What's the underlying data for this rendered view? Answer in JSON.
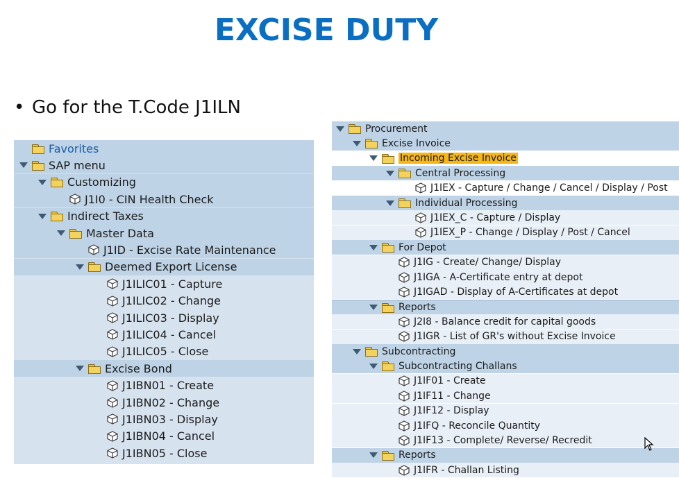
{
  "title": "EXCISE DUTY",
  "bullet": {
    "text": "Go for the T.Code J1ILN"
  },
  "colors": {
    "title": "#0a6fc2",
    "highlight": "#f5b617",
    "band": "#bed3e6",
    "panel": "#d6e2ee"
  },
  "left_tree": [
    {
      "label": "Favorites",
      "indent": 0,
      "node": "folder",
      "expander": "none",
      "style": "band",
      "fav": true
    },
    {
      "label": "SAP menu",
      "indent": 0,
      "node": "folder",
      "expander": "open",
      "style": "band"
    },
    {
      "label": "Customizing",
      "indent": 1,
      "node": "folder",
      "expander": "open",
      "style": "band"
    },
    {
      "label": "J1I0 - CIN Health Check",
      "indent": 2,
      "node": "cube",
      "expander": "none",
      "style": "band"
    },
    {
      "label": "Indirect Taxes",
      "indent": 1,
      "node": "folder",
      "expander": "open",
      "style": "band"
    },
    {
      "label": "Master Data",
      "indent": 2,
      "node": "folder",
      "expander": "open",
      "style": "band"
    },
    {
      "label": "J1ID - Excise Rate Maintenance",
      "indent": 3,
      "node": "cube",
      "expander": "none",
      "style": "band"
    },
    {
      "label": "Deemed Export License",
      "indent": 3,
      "node": "folder",
      "expander": "open",
      "style": "band"
    },
    {
      "label": "J1ILIC01 - Capture",
      "indent": 4,
      "node": "cube",
      "expander": "none",
      "style": "panel"
    },
    {
      "label": "J1ILIC02 - Change",
      "indent": 4,
      "node": "cube",
      "expander": "none",
      "style": "panel"
    },
    {
      "label": "J1ILIC03 - Display",
      "indent": 4,
      "node": "cube",
      "expander": "none",
      "style": "panel"
    },
    {
      "label": "J1ILIC04 - Cancel",
      "indent": 4,
      "node": "cube",
      "expander": "none",
      "style": "panel"
    },
    {
      "label": "J1ILIC05 - Close",
      "indent": 4,
      "node": "cube",
      "expander": "none",
      "style": "panel"
    },
    {
      "label": "Excise Bond",
      "indent": 3,
      "node": "folder",
      "expander": "open",
      "style": "band"
    },
    {
      "label": "J1IBN01 - Create",
      "indent": 4,
      "node": "cube",
      "expander": "none",
      "style": "panel"
    },
    {
      "label": "J1IBN02 - Change",
      "indent": 4,
      "node": "cube",
      "expander": "none",
      "style": "panel"
    },
    {
      "label": "J1IBN03 - Display",
      "indent": 4,
      "node": "cube",
      "expander": "none",
      "style": "panel"
    },
    {
      "label": "J1IBN04 - Cancel",
      "indent": 4,
      "node": "cube",
      "expander": "none",
      "style": "panel"
    },
    {
      "label": "J1IBN05 - Close",
      "indent": 4,
      "node": "cube",
      "expander": "none",
      "style": "panel"
    }
  ],
  "right_tree": [
    {
      "label": "Procurement",
      "indent": 0,
      "node": "folder",
      "expander": "open",
      "style": "band"
    },
    {
      "label": "Excise Invoice",
      "indent": 1,
      "node": "folder",
      "expander": "open",
      "style": "band"
    },
    {
      "label": "Incoming Excise Invoice",
      "indent": 2,
      "node": "folder",
      "expander": "open",
      "style": "white",
      "highlight": true
    },
    {
      "label": "Central Processing",
      "indent": 3,
      "node": "folder",
      "expander": "open",
      "style": "band"
    },
    {
      "label": "J1IEX - Capture / Change / Cancel /  Display /  Post",
      "indent": 4,
      "node": "cube",
      "expander": "none",
      "style": "white"
    },
    {
      "label": "Individual Processing",
      "indent": 3,
      "node": "folder",
      "expander": "open",
      "style": "band"
    },
    {
      "label": "J1IEX_C - Capture / Display",
      "indent": 4,
      "node": "cube",
      "expander": "none",
      "style": "light"
    },
    {
      "label": "J1IEX_P - Change / Display / Post / Cancel",
      "indent": 4,
      "node": "cube",
      "expander": "none",
      "style": "light"
    },
    {
      "label": "For Depot",
      "indent": 2,
      "node": "folder",
      "expander": "open",
      "style": "band"
    },
    {
      "label": "J1IG - Create/ Change/ Display",
      "indent": 3,
      "node": "cube",
      "expander": "none",
      "style": "light"
    },
    {
      "label": "J1IGA - A-Certificate  entry at depot",
      "indent": 3,
      "node": "cube",
      "expander": "none",
      "style": "light"
    },
    {
      "label": "J1IGAD - Display of A-Certificates at depot",
      "indent": 3,
      "node": "cube",
      "expander": "none",
      "style": "light"
    },
    {
      "label": "Reports",
      "indent": 2,
      "node": "folder",
      "expander": "open",
      "style": "band",
      "sep": true
    },
    {
      "label": "J2I8 - Balance credit for capital goods",
      "indent": 3,
      "node": "cube",
      "expander": "none",
      "style": "light"
    },
    {
      "label": "J1IGR - List of GR's without Excise Invoice",
      "indent": 3,
      "node": "cube",
      "expander": "none",
      "style": "light"
    },
    {
      "label": "Subcontracting",
      "indent": 1,
      "node": "folder",
      "expander": "open",
      "style": "band"
    },
    {
      "label": "Subcontracting Challans",
      "indent": 2,
      "node": "folder",
      "expander": "open",
      "style": "band"
    },
    {
      "label": "J1IF01 - Create",
      "indent": 3,
      "node": "cube",
      "expander": "none",
      "style": "light"
    },
    {
      "label": "J1IF11 - Change",
      "indent": 3,
      "node": "cube",
      "expander": "none",
      "style": "light"
    },
    {
      "label": "J1IF12 - Display",
      "indent": 3,
      "node": "cube",
      "expander": "none",
      "style": "light"
    },
    {
      "label": "J1IFQ - Reconcile Quantity",
      "indent": 3,
      "node": "cube",
      "expander": "none",
      "style": "light"
    },
    {
      "label": "J1IF13 - Complete/ Reverse/ Recredit",
      "indent": 3,
      "node": "cube",
      "expander": "none",
      "style": "light"
    },
    {
      "label": "Reports",
      "indent": 2,
      "node": "folder",
      "expander": "open",
      "style": "band"
    },
    {
      "label": "J1IFR - Challan Listing",
      "indent": 3,
      "node": "cube",
      "expander": "none",
      "style": "light"
    }
  ]
}
